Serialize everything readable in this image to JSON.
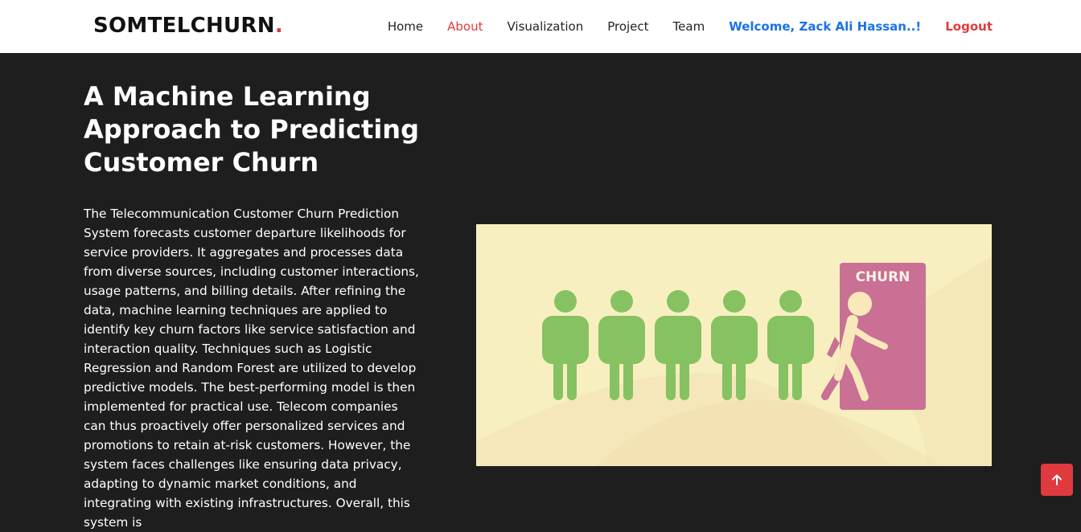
{
  "navbar": {
    "brand": "SOMTELCHURN",
    "brand_dot": ".",
    "links": [
      {
        "label": "Home"
      },
      {
        "label": "About"
      },
      {
        "label": "Visualization"
      },
      {
        "label": "Project"
      },
      {
        "label": "Team"
      }
    ],
    "welcome": "Welcome, Zack Ali Hassan..!",
    "logout": "Logout"
  },
  "hero": {
    "title": "A Machine Learning Approach to Predicting Customer Churn",
    "paragraph": "The Telecommunication Customer Churn Prediction System forecasts customer departure likelihoods for service providers. It aggregates and processes data from diverse sources, including customer interactions, usage patterns, and billing details. After refining the data, machine learning techniques are applied to identify key churn factors like service satisfaction and interaction quality. Techniques such as Logistic Regression and Random Forest are utilized to develop predictive models. The best-performing model is then implemented for practical use. Telecom companies can thus proactively offer personalized services and promotions to retain at-risk customers. However, the system faces challenges like ensuring data privacy, adapting to dynamic market conditions, and integrating with existing infrastructures. Overall, this system is"
  },
  "illustration": {
    "door_label": "CHURN",
    "colors": {
      "background": "#f8efc1",
      "person": "#86c262",
      "door": "#c97094",
      "walker": "#f9e9ba"
    }
  },
  "colors": {
    "accent": "#e03a3e",
    "welcome": "#1a73e8",
    "page_background": "#1e1e1f"
  },
  "scroll_top": {
    "icon": "arrow-up-icon"
  }
}
